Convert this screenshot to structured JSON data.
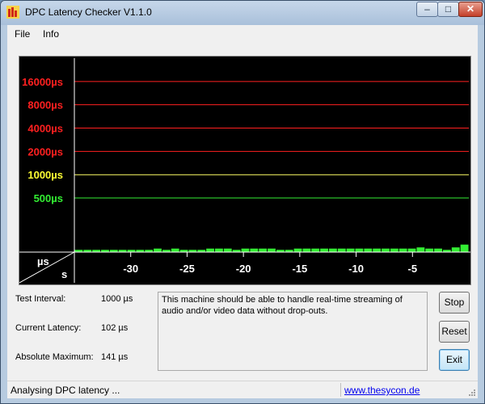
{
  "window": {
    "title": "DPC Latency Checker V1.1.0",
    "controls": {
      "minimize": "–",
      "maximize": "□",
      "close": "✕"
    }
  },
  "menu": [
    "File",
    "Info"
  ],
  "chart_data": {
    "type": "bar",
    "y_scale": "log",
    "ylim": [
      100,
      32000
    ],
    "xlim": [
      -35,
      0
    ],
    "background": "#000000",
    "bar_color": "#33ee33",
    "thresholds": [
      {
        "label": "16000µs",
        "value": 16000,
        "color": "#ff2020",
        "line": "#ff2020"
      },
      {
        "label": "8000µs",
        "value": 8000,
        "color": "#ff2020",
        "line": "#ff2020"
      },
      {
        "label": "4000µs",
        "value": 4000,
        "color": "#ff2020",
        "line": "#ff2020"
      },
      {
        "label": "2000µs",
        "value": 2000,
        "color": "#ff2020",
        "line": "#ff2020"
      },
      {
        "label": "1000µs",
        "value": 1000,
        "color": "#ffff33",
        "line": "#ffff66"
      },
      {
        "label": "500µs",
        "value": 500,
        "color": "#33ee33",
        "line": "#33ee33"
      }
    ],
    "x_ticks": [
      -30,
      -25,
      -20,
      -15,
      -10,
      -5
    ],
    "x_tick_labels": [
      "-30",
      "-25",
      "-20",
      "-15",
      "-10",
      "-5"
    ],
    "unit_label_y": "µs",
    "unit_label_x": "s",
    "values": [
      107,
      107,
      107,
      107,
      107,
      107,
      107,
      107,
      107,
      111,
      107,
      111,
      107,
      107,
      107,
      111,
      111,
      111,
      107,
      111,
      111,
      111,
      111,
      107,
      107,
      111,
      111,
      111,
      111,
      111,
      111,
      111,
      111,
      111,
      111,
      111,
      111,
      111,
      111,
      115,
      111,
      111,
      107,
      115,
      125
    ]
  },
  "stats": {
    "interval_label": "Test Interval:",
    "interval_value": "1000 µs",
    "current_label": "Current Latency:",
    "current_value": "102 µs",
    "max_label": "Absolute Maximum:",
    "max_value": "141 µs"
  },
  "message": "This machine should be able to handle real-time streaming of audio and/or video data without drop-outs.",
  "buttons": {
    "stop": "Stop",
    "reset": "Reset",
    "exit": "Exit"
  },
  "status": {
    "text": "Analysing DPC latency ...",
    "link": "www.thesycon.de"
  },
  "colors": {
    "title_bg": "#b7cbe0",
    "chart_bg": "#000000",
    "bars": "#33ee33",
    "link": "#0000ee"
  }
}
